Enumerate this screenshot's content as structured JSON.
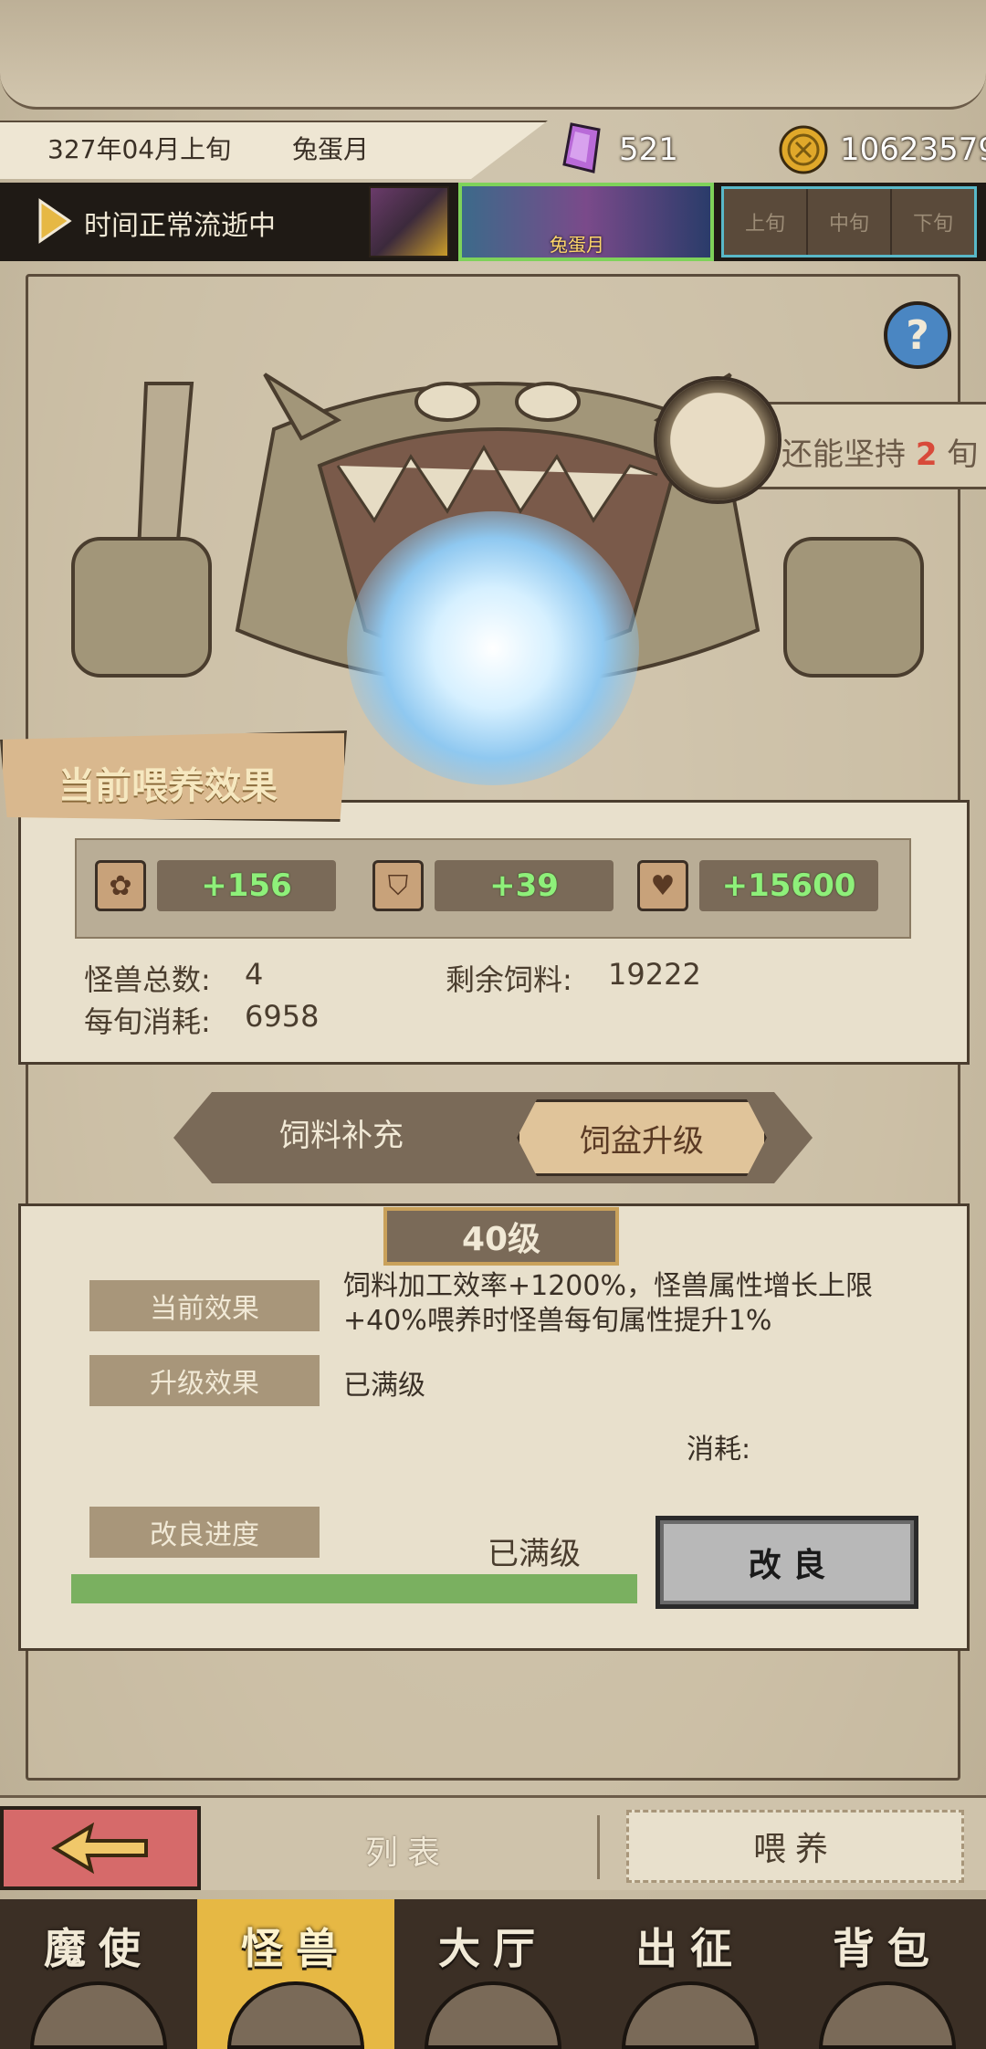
{
  "header": {
    "date": "327年04月上旬",
    "month_name": "兔蛋月",
    "crystal_count": "521",
    "coin_count": "10623579"
  },
  "time_bar": {
    "status": "时间正常流逝中",
    "current_label": "兔蛋月",
    "periods": [
      "上旬",
      "中旬",
      "下旬"
    ]
  },
  "persist": {
    "prefix": "还能坚持",
    "count": "2",
    "suffix": "旬"
  },
  "feed_effect": {
    "title": "当前喂养效果",
    "stats": [
      {
        "icon": "paw-icon",
        "value": "+156"
      },
      {
        "icon": "shield-icon",
        "value": "+39"
      },
      {
        "icon": "heart-icon",
        "value": "+15600"
      }
    ],
    "monster_total_label": "怪兽总数:",
    "monster_total": "4",
    "remaining_feed_label": "剩余饲料:",
    "remaining_feed": "19222",
    "per_period_label": "每旬消耗:",
    "per_period": "6958"
  },
  "tabs": {
    "feed_supply": "饲料补充",
    "bowl_upgrade": "饲盆升级"
  },
  "upgrade": {
    "level": "40级",
    "current_effect_label": "当前效果",
    "current_effect": "饲料加工效率+1200%，怪兽属性增长上限+40%喂养时怪兽每旬属性提升1%",
    "upgrade_effect_label": "升级效果",
    "upgrade_effect": "已满级",
    "cost_label": "消耗:",
    "progress_label": "改良进度",
    "progress_text": "已满级",
    "progress": 1.0,
    "improve_button": "改 良"
  },
  "actions": {
    "list": "列表",
    "feed": "喂养"
  },
  "nav": [
    {
      "label": "魔使",
      "active": false
    },
    {
      "label": "怪兽",
      "active": true
    },
    {
      "label": "大厅",
      "active": false
    },
    {
      "label": "出征",
      "active": false
    },
    {
      "label": "背包",
      "active": false
    }
  ],
  "colors": {
    "accent_green": "#8ef07a",
    "active_nav": "#e6b844",
    "back_button": "#d66a6a",
    "progress_fill": "#7ab060"
  }
}
